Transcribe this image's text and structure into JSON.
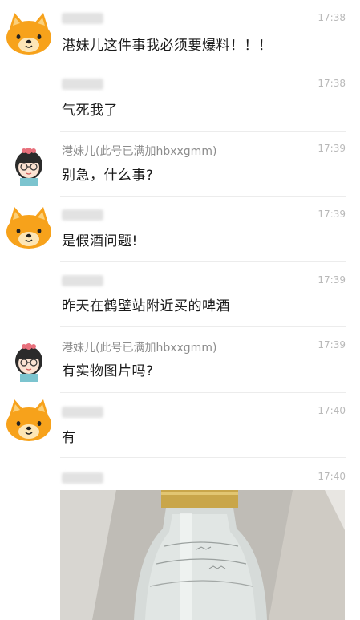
{
  "messages": [
    {
      "sender": "",
      "time": "17:38",
      "text": "港妹儿这件事我必须要爆料！！！"
    },
    {
      "sender": "",
      "time": "17:38",
      "text": "气死我了"
    },
    {
      "sender": "港妹儿(此号已满加hbxxgmm)",
      "time": "17:39",
      "text": "别急，什么事?"
    },
    {
      "sender": "",
      "time": "17:39",
      "text": "是假酒问题!"
    },
    {
      "sender": "",
      "time": "17:39",
      "text": "昨天在鹤壁站附近买的啤酒"
    },
    {
      "sender": "港妹儿(此号已满加hbxxgmm)",
      "time": "17:39",
      "text": "有实物图片吗?"
    },
    {
      "sender": "",
      "time": "17:40",
      "text": "有"
    },
    {
      "sender": "",
      "time": "17:40",
      "text": ""
    }
  ],
  "colors": {
    "background": "#ffffff",
    "timestamp": "#b9b9b9",
    "name": "#8c8c8c",
    "bear": "#f7a21b",
    "divider": "#ececec"
  },
  "icons": {
    "bear_avatar": "bear-avatar-icon",
    "girl_avatar": "girl-avatar-icon"
  }
}
